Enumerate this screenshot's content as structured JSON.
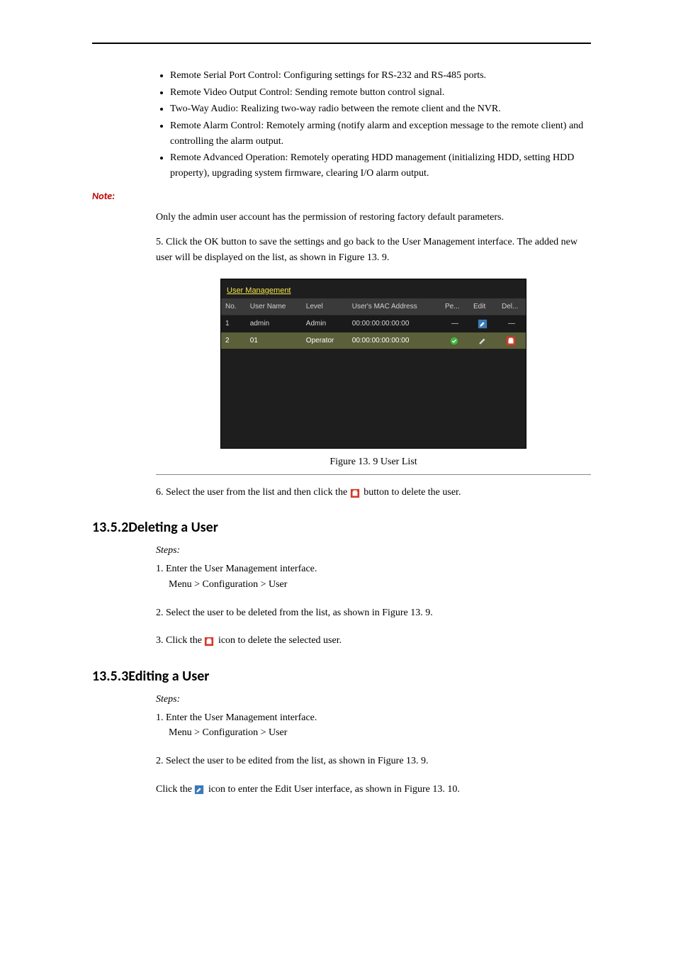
{
  "bullets1": [
    "Remote Serial Port Control: Configuring settings for RS-232 and RS-485 ports.",
    "Remote Video Output Control: Sending remote button control signal.",
    "Two-Way Audio: Realizing two-way radio between the remote client and the NVR.",
    "Remote Alarm Control: Remotely arming (notify alarm and exception message to the remote client) and controlling the alarm output.",
    "Remote Advanced Operation: Remotely operating HDD management (initializing HDD, setting HDD property), upgrading system firmware, clearing I/O alarm output."
  ],
  "note_label": "Note:",
  "note_text": "Only the admin user account has the permission of restoring factory default parameters.",
  "step5_num": "5.",
  "step5_text_a": "Click the ",
  "step5_text_b": "OK",
  "step5_text_c": " button to save the settings and go back to the User Management interface. The added new user will be displayed on the list, as shown in Figure 13. 9.",
  "caption1": "Figure 13. 9 User List",
  "step6_num": "6.",
  "step6_text_a": "Select the user from the list and then click the ",
  "step6_text_b": " button to delete the user.",
  "heading_deleting": "13.5.2Deleting a User",
  "del_subhead": "Steps:",
  "del_s1": "1. Enter the User Management interface.",
  "del_s1_path": "Menu > Configuration > User",
  "del_s2": "2. Select the user to be deleted from the list, as shown in Figure 13. 9.",
  "del_s3_a": "3. Click the ",
  "del_s3_b": " icon to delete the selected user.",
  "heading_editing": "13.5.3Editing a User",
  "edit_subhead": "Steps:",
  "edit_s1": "1. Enter the User Management interface.",
  "edit_s1_path": "Menu > Configuration > User",
  "edit_s2": "2. Select the user to be edited from the list, as shown in Figure 13. 9.",
  "edit_s3_a": "Click the ",
  "edit_s3_b": " icon to enter the Edit User interface, as shown in Figure 13. 10.",
  "ui": {
    "tab": "User Management",
    "headers": [
      "No.",
      "User Name",
      "Level",
      "User's MAC Address",
      "Pe...",
      "Edit",
      "Del..."
    ],
    "rows": [
      {
        "no": "1",
        "user": "admin",
        "level": "Admin",
        "mac": "00:00:00:00:00:00",
        "perm": "—",
        "edit": "edit",
        "del": "—",
        "selected": false
      },
      {
        "no": "2",
        "user": "01",
        "level": "Operator",
        "mac": "00:00:00:00:00:00",
        "perm": "check",
        "edit": "edit",
        "del": "trash",
        "selected": true
      }
    ]
  }
}
